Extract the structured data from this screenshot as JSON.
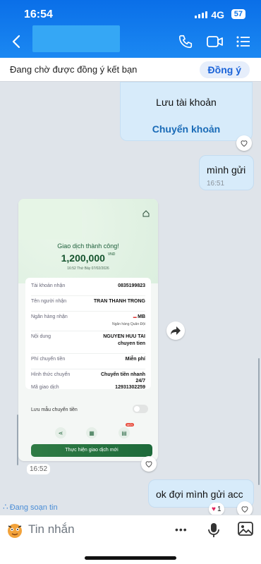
{
  "status_bar": {
    "time": "16:54",
    "network": "4G",
    "battery": "57"
  },
  "header": {
    "call_icon": "phone-icon",
    "video_icon": "video-icon",
    "menu_icon": "list-icon"
  },
  "friend_bar": {
    "text": "Đang chờ được đồng ý kết bạn",
    "button": "Đồng ý"
  },
  "card": {
    "title": "Lưu tài khoản",
    "link": "Chuyển khoản"
  },
  "messages": {
    "m1": {
      "text": "mình gửi",
      "time": "16:51"
    },
    "received_time": "16:52",
    "m2": {
      "text": "ok đợi mình gửi acc"
    }
  },
  "receipt": {
    "success": "Giao dịch thành công!",
    "amount": "1,200,000",
    "currency": "VND",
    "datetime": "16:52 Thứ Bảy 07/02/2026",
    "rows": [
      {
        "label": "Tài khoản nhận",
        "value": "0835199823"
      },
      {
        "label": "Tên người nhận",
        "value": "TRAN THANH TRONG"
      },
      {
        "label": "Ngân hàng nhận",
        "value": "MB",
        "sub": "Ngân hàng Quân Đội"
      },
      {
        "label": "Nội dung",
        "value": "NGUYEN HUU TAI",
        "sub": "chuyen tien"
      },
      {
        "label": "Phí chuyển tiền",
        "value": "Miễn phí"
      },
      {
        "label": "Hình thức chuyển",
        "value": "Chuyển tiền nhanh",
        "sub": "24/7"
      },
      {
        "label": "Mã giao dịch",
        "value": "12931302259"
      }
    ],
    "save_template": "Lưu mẫu chuyển tiền",
    "new_badge": "MỚI",
    "new_tx_button": "Thực hiện giao dịch mới"
  },
  "reaction": {
    "count": "1"
  },
  "typing": "Đang soạn tin",
  "input": {
    "placeholder": "Tin nhắn",
    "more": "•••"
  }
}
